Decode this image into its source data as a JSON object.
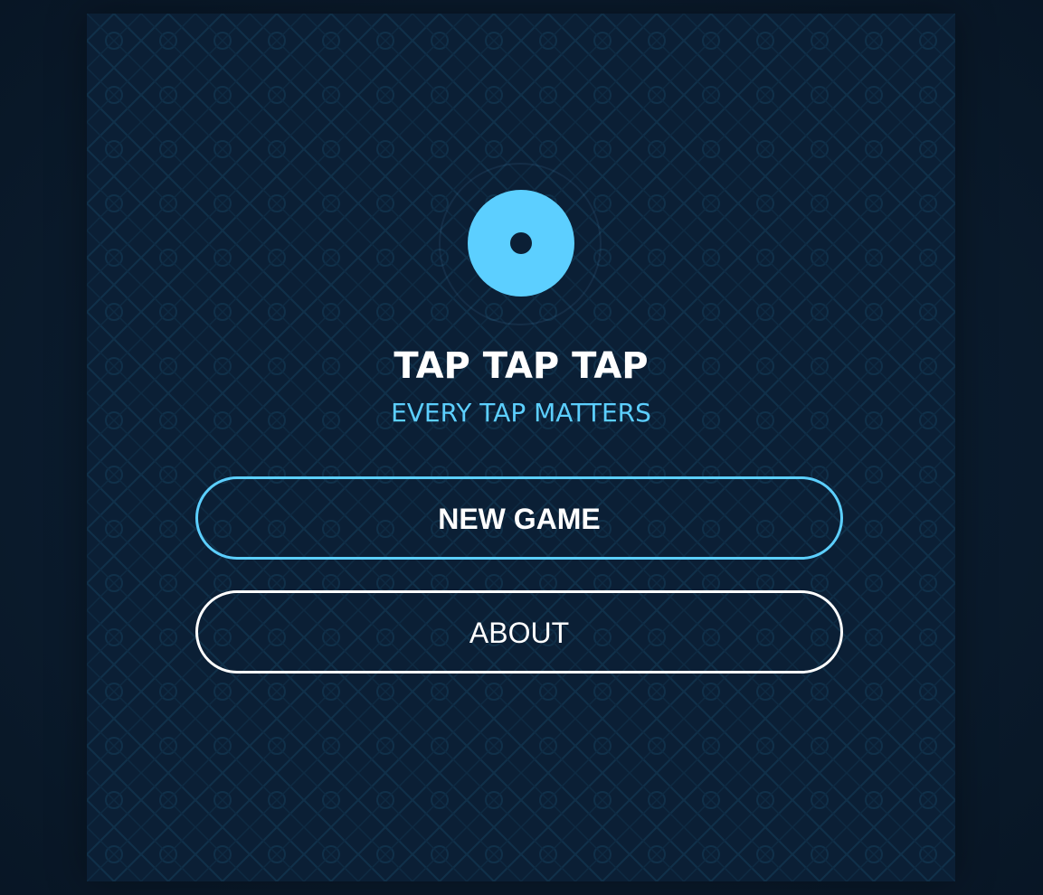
{
  "game": {
    "title": "TAP TAP TAP",
    "subtitle": "EVERY TAP MATTERS",
    "logo_icon": "tap-target-icon"
  },
  "menu": {
    "new_game_label": "NEW GAME",
    "about_label": "ABOUT"
  },
  "colors": {
    "background": "#0a1a2b",
    "panel": "#0b1f35",
    "accent": "#5ccfff",
    "text": "#ffffff"
  }
}
